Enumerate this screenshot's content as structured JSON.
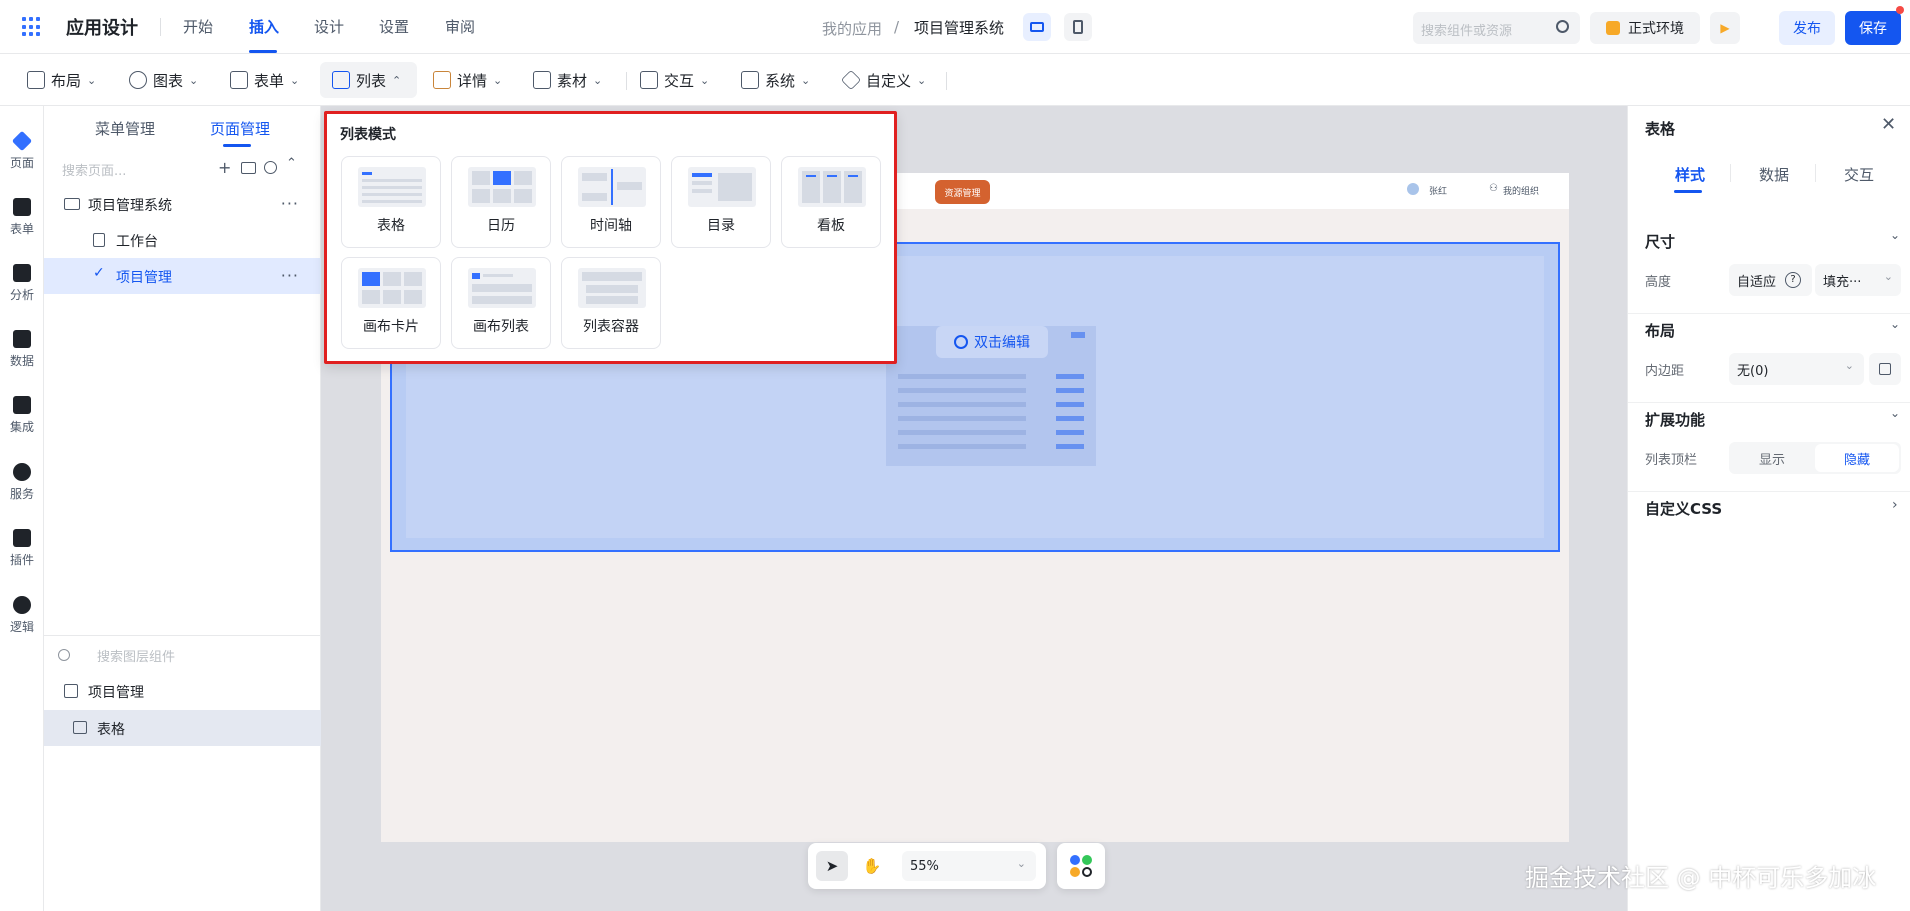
{
  "app": {
    "title": "应用设计"
  },
  "nav": {
    "items": [
      "开始",
      "插入",
      "设计",
      "设置",
      "审阅"
    ]
  },
  "breadcrumb": {
    "root": "我的应用",
    "sep": "/",
    "current": "项目管理系统"
  },
  "header": {
    "search_placeholder": "搜索组件或资源",
    "env_label": "正式环境",
    "publish": "发布",
    "save": "保存"
  },
  "toolbar": {
    "items": [
      "布局",
      "图表",
      "表单",
      "列表",
      "详情",
      "素材",
      "交互",
      "系统",
      "自定义"
    ]
  },
  "iconbar": {
    "items": [
      "页面",
      "表单",
      "分析",
      "数据",
      "集成",
      "服务",
      "插件",
      "逻辑"
    ]
  },
  "left": {
    "tabs": [
      "菜单管理",
      "页面管理"
    ],
    "search_placeholder": "搜索页面...",
    "tree": [
      {
        "label": "项目管理系统"
      },
      {
        "label": "工作台"
      },
      {
        "label": "项目管理"
      }
    ],
    "layer_search_placeholder": "搜索图层组件",
    "layers": [
      {
        "label": "项目管理"
      },
      {
        "label": "表格"
      }
    ]
  },
  "popup": {
    "title": "列表模式",
    "cards": [
      "表格",
      "日历",
      "时间轴",
      "目录",
      "看板",
      "画布卡片",
      "画布列表",
      "列表容器"
    ]
  },
  "canvas": {
    "header_tag": "资源管理",
    "user": "张红",
    "org": "我的组织",
    "edit_hint": "双击编辑",
    "zoom": "55%"
  },
  "right": {
    "title": "表格",
    "tabs": [
      "样式",
      "数据",
      "交互"
    ],
    "size_title": "尺寸",
    "height_label": "高度",
    "height_value": "自适应",
    "fill_value": "填充···",
    "layout_title": "布局",
    "padding_label": "内边距",
    "padding_value": "无(0)",
    "ext_title": "扩展功能",
    "topbar_label": "列表顶栏",
    "show": "显示",
    "hide": "隐藏",
    "css_title": "自定义CSS"
  },
  "watermark": "掘金技术社区 @ 中杯可乐多加冰",
  "colors": {
    "accent": "#1456f0",
    "highlight_border": "#e02020",
    "selection": "#b8ccf4",
    "tag": "#d4622f"
  }
}
